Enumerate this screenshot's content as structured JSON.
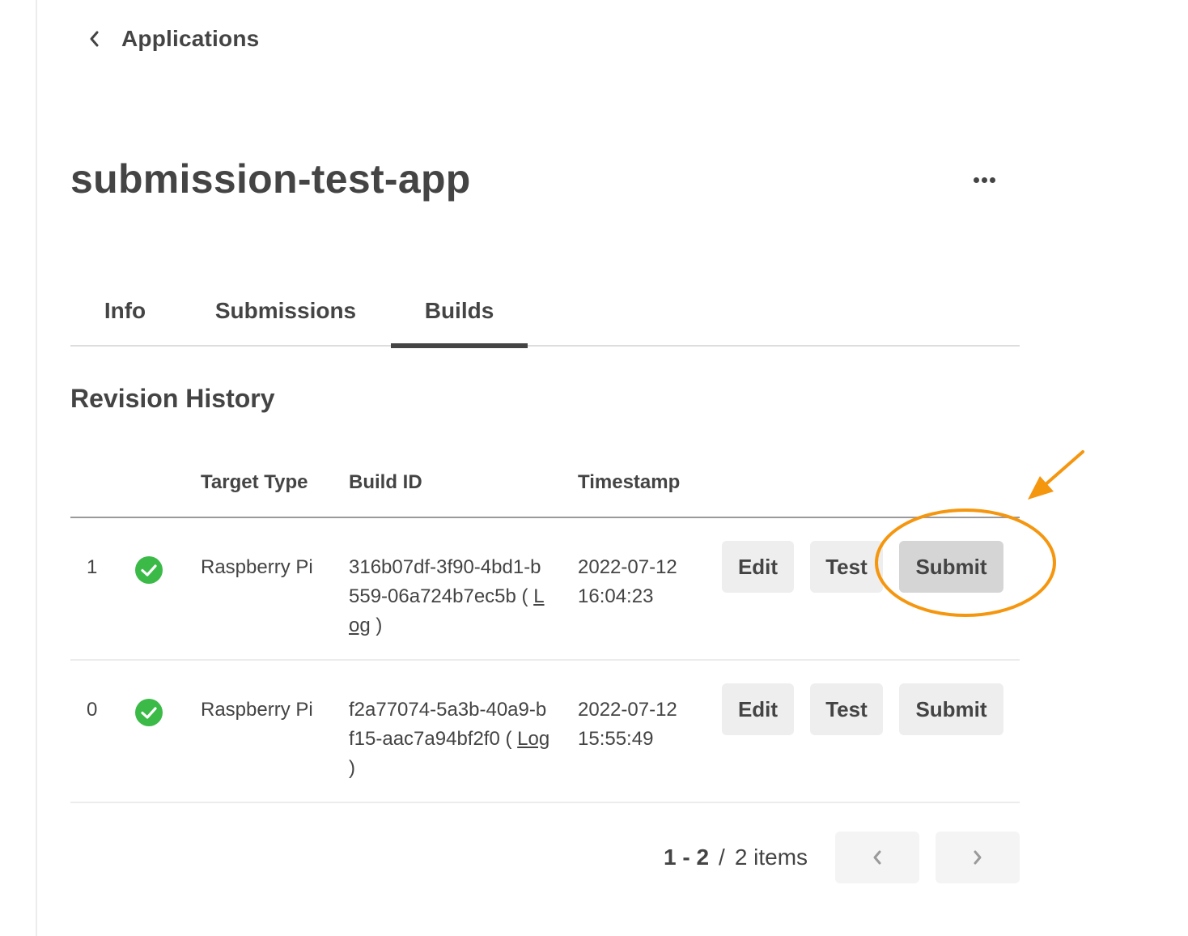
{
  "nav": {
    "back_label": "Applications",
    "back_icon": "chevron-left-icon"
  },
  "header": {
    "title": "submission-test-app",
    "more_icon": "more-horizontal-icon"
  },
  "tabs": [
    {
      "label": "Info",
      "active": false
    },
    {
      "label": "Submissions",
      "active": false
    },
    {
      "label": "Builds",
      "active": true
    }
  ],
  "section": {
    "title": "Revision History"
  },
  "table": {
    "columns": [
      "",
      "",
      "Target Type",
      "Build ID",
      "Timestamp",
      ""
    ],
    "rows": [
      {
        "index": "1",
        "status": "success",
        "target_type": "Raspberry Pi",
        "build_id": "316b07df-3f90-4bd1-b559-06a724b7ec5b",
        "log_label": "Log",
        "timestamp_date": "2022-07-12",
        "timestamp_time": "16:04:23",
        "actions": {
          "edit": "Edit",
          "test": "Test",
          "submit": "Submit"
        },
        "highlighted": true
      },
      {
        "index": "0",
        "status": "success",
        "target_type": "Raspberry Pi",
        "build_id": "f2a77074-5a3b-40a9-bf15-aac7a94bf2f0",
        "log_label": "Log",
        "timestamp_date": "2022-07-12",
        "timestamp_time": "15:55:49",
        "actions": {
          "edit": "Edit",
          "test": "Test",
          "submit": "Submit"
        },
        "highlighted": false
      }
    ]
  },
  "pagination": {
    "range": "1 - 2",
    "separator": "/",
    "total": "2 items"
  },
  "colors": {
    "status_success": "#3cba48",
    "annotation": "#f5960f",
    "text": "#444444"
  }
}
